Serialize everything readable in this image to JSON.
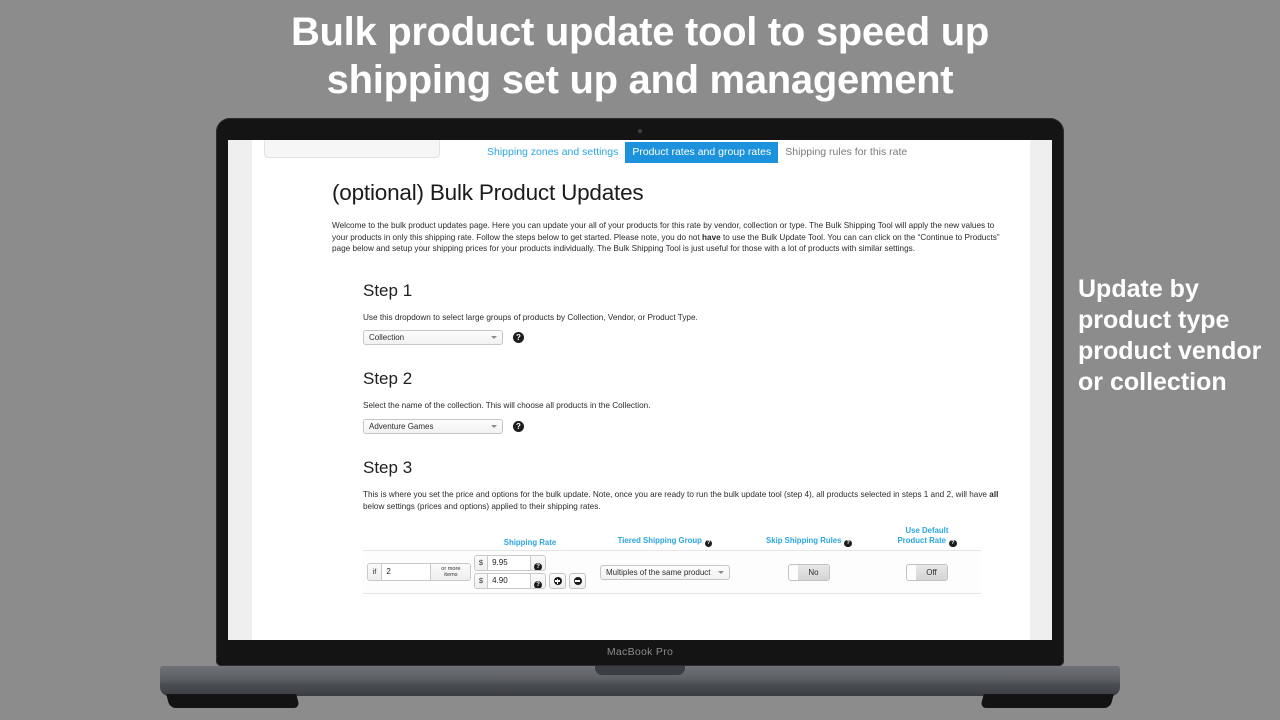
{
  "promo": {
    "headline_lines": [
      "Bulk product update tool to speed up",
      "shipping set up and management"
    ],
    "side_caption_lines": [
      "Update by",
      "product type",
      "product vendor",
      "or collection"
    ],
    "text_color": "#ffffff",
    "background_color": "#8c8c8c"
  },
  "device": {
    "label": "MacBook Pro"
  },
  "tabs": [
    {
      "label": "Shipping zones and settings",
      "state": "link"
    },
    {
      "label": "Product rates and group rates",
      "state": "active"
    },
    {
      "label": "Shipping rules for this rate",
      "state": "muted"
    }
  ],
  "accent_color": "#1b92db",
  "link_color": "#2ba6e0",
  "page": {
    "title": "(optional) Bulk Product Updates",
    "intro_before": "Welcome to the bulk product updates page. Here you can update your all of your products for this rate by vendor, collection or type. The Bulk Shipping Tool will apply the new values to your products in only this shipping rate. Follow the steps below to get started. Please note, you do not ",
    "intro_bold": "have",
    "intro_after": " to use the Bulk Update Tool. You can can click on the “Continue to Products” page below and setup your shipping prices for your products individually. The Bulk Shipping Tool is just useful for those with a lot of products with similar settings."
  },
  "step1": {
    "heading": "Step 1",
    "description": "Use this dropdown to select large groups of products by Collection, Vendor, or Product Type.",
    "select_value": "Collection",
    "help_glyph": "?"
  },
  "step2": {
    "heading": "Step 2",
    "description": "Select the name of the collection. This will choose all products in the Collection.",
    "select_value": "Adventure Games",
    "help_glyph": "?"
  },
  "step3": {
    "heading": "Step 3",
    "description_before": "This is where you set the price and options for the bulk update. Note, once you are ready to run the bulk update tool (step 4), all products selected in steps 1 and 2, will have ",
    "description_bold": "all",
    "description_after": " below settings (prices and options) applied to their shipping rates.",
    "columns": {
      "tier": "",
      "shipping_rate": "Shipping Rate",
      "tiered_group": "Tiered Shipping Group",
      "skip_rules": "Skip Shipping Rules",
      "use_default_line1": "Use Default",
      "use_default_line2": "Product Rate",
      "help_glyph": "?"
    },
    "row": {
      "if_label": "if",
      "if_value": "2",
      "or_more_line1": "or more",
      "or_more_line2": "items",
      "currency_symbol": "$",
      "rate_primary": "9.95",
      "rate_secondary": "4.90",
      "add_button": "+",
      "remove_button": "−",
      "tiered_group_value": "Multiples of the same product",
      "skip_rules_value": "No",
      "use_default_value": "Off"
    }
  }
}
